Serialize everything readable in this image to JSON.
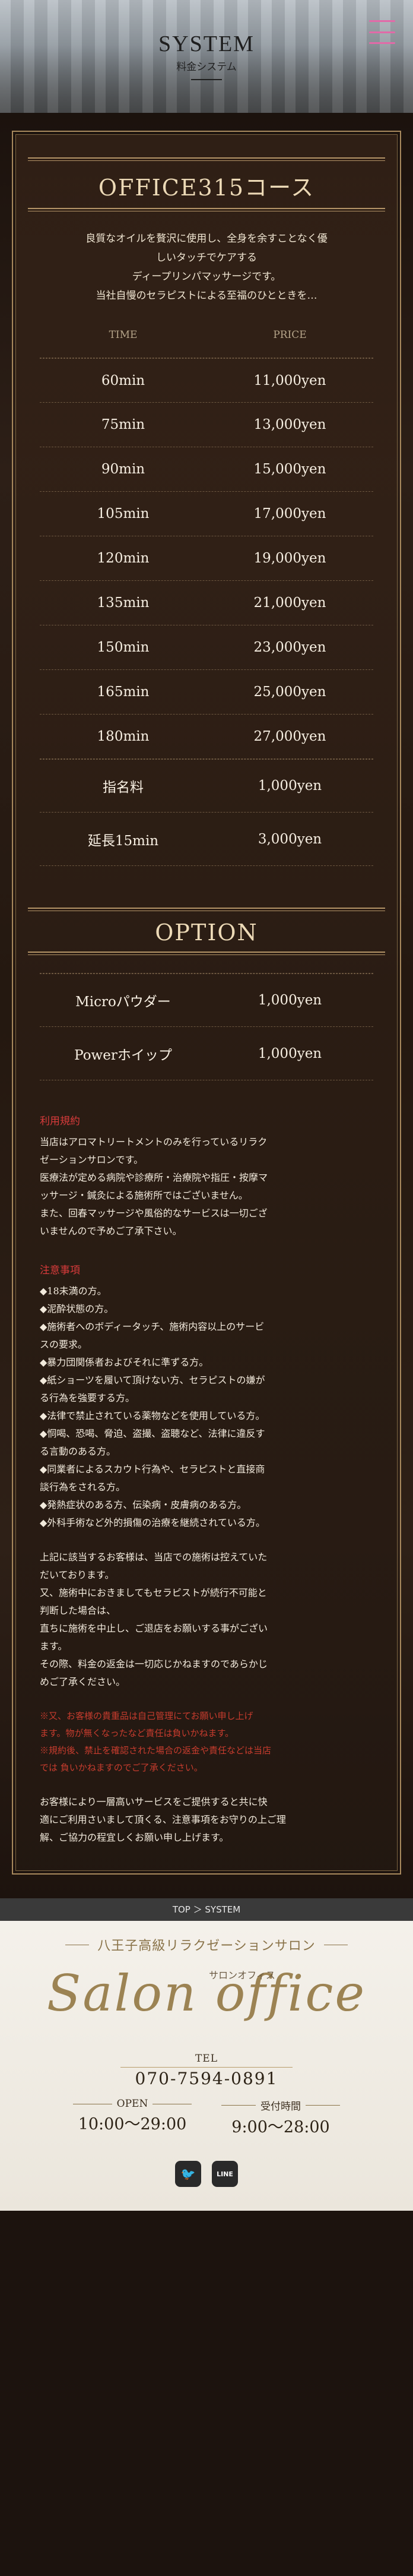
{
  "header": {
    "title": "SYSTEM",
    "subtitle": "料金システム",
    "menu_icon": "hamburger-icon"
  },
  "course": {
    "title": "OFFICE315コース",
    "intro": [
      "良質なオイルを贅沢に使用し、全身を余すことなく優",
      "しいタッチでケアする",
      "ディープリンパマッサージです。",
      "当社自慢のセラピストによる至福のひとときを…"
    ],
    "col_time": "TIME",
    "col_price": "PRICE",
    "rows": [
      {
        "time": "60min",
        "price": "11,000yen"
      },
      {
        "time": "75min",
        "price": "13,000yen"
      },
      {
        "time": "90min",
        "price": "15,000yen"
      },
      {
        "time": "105min",
        "price": "17,000yen"
      },
      {
        "time": "120min",
        "price": "19,000yen"
      },
      {
        "time": "135min",
        "price": "21,000yen"
      },
      {
        "time": "150min",
        "price": "23,000yen"
      },
      {
        "time": "165min",
        "price": "25,000yen"
      },
      {
        "time": "180min",
        "price": "27,000yen"
      }
    ],
    "extras": [
      {
        "label": "指名料",
        "price": "1,000yen"
      },
      {
        "label": "延長15min",
        "price": "3,000yen"
      }
    ]
  },
  "option": {
    "title": "OPTION",
    "rows": [
      {
        "label": "Microパウダー",
        "price": "1,000yen"
      },
      {
        "label": "Powerホイップ",
        "price": "1,000yen"
      }
    ]
  },
  "terms": {
    "title": "利用規約",
    "lines": [
      "当店はアロマトリートメントのみを行っているリラク",
      "ゼーションサロンです。",
      "医療法が定める病院や診療所・治療院や指圧・按摩マ",
      "ッサージ・鍼灸による施術所ではございません。",
      "また、回春マッサージや風俗的なサービスは一切ござ",
      "いませんので予めご了承下さい。"
    ]
  },
  "caution": {
    "title": "注意事項",
    "items": [
      "◆18未満の方。",
      "◆泥酔状態の方。",
      "◆施術者へのボディータッチ、施術内容以上のサービ",
      "スの要求。",
      "◆暴力団関係者およびそれに準ずる方。",
      "◆紙ショーツを履いて頂けない方、セラピストの嫌が",
      "る行為を強要する方。",
      "◆法律で禁止されている薬物などを使用している方。",
      "◆恫喝、恐喝、脅迫、盗撮、盗聴など、法律に違反す",
      "る言動のある方。",
      "◆同業者によるスカウト行為や、セラピストと直接商",
      "談行為をされる方。",
      "◆発熱症状のある方、伝染病・皮膚病のある方。",
      "◆外科手術など外的損傷の治療を継続されている方。"
    ],
    "after": [
      "上記に該当するお客様は、当店での施術は控えていた",
      "だいております。",
      "又、施術中におきましてもセラピストが続行不可能と",
      "判断した場合は、",
      "直ちに施術を中止し、ご退店をお願いする事がござい",
      "ます。",
      "その際、料金の返金は一切応じかねますのであらかじ",
      "めご了承ください。"
    ],
    "red": [
      "※又、お客様の貴重品は自己管理にてお願い申し上げ",
      "ます。物が無くなったなど責任は負いかねます。",
      "※規約後、禁止を確認された場合の返金や責任などは当店",
      "では 負いかねますのでご了承ください。"
    ],
    "closing": [
      "お客様により一層高いサービスをご提供すると共に快",
      "適にご利用さいまして頂くる、注意事項をお守りの上ご理",
      "解、ご協力の程宜しくお願い申し上げます。"
    ]
  },
  "footer": {
    "breadcrumb": "TOP ＞ SYSTEM",
    "tagline": "八王子高級リラクゼーションサロン",
    "logo": "Salon office",
    "logo_kana": "サロンオフィス",
    "tel_label": "TEL",
    "tel": "070-7594-0891",
    "open_label": "OPEN",
    "open": "10:00～29:00",
    "reception_label": "受付時間",
    "reception": "9:00～28:00",
    "social": [
      {
        "name": "twitter-icon",
        "glyph": "🐦"
      },
      {
        "name": "line-icon",
        "glyph": "LINE"
      }
    ]
  }
}
